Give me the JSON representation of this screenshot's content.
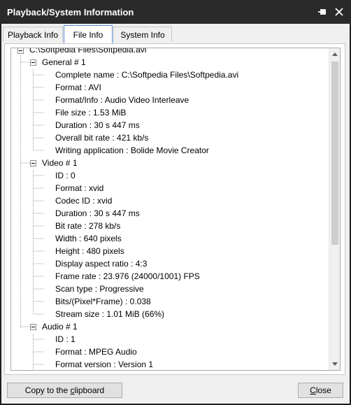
{
  "window": {
    "title": "Playback/System Information",
    "pin_icon": "pin-icon",
    "close_icon": "close-icon"
  },
  "tabs": [
    {
      "label": "Playback Info",
      "active": false
    },
    {
      "label": "File Info",
      "active": true
    },
    {
      "label": "System Info",
      "active": false
    }
  ],
  "tree": {
    "root": "C:\\Softpedia Files\\Softpedia.avi",
    "sections": [
      {
        "label": "General # 1",
        "items": [
          "Complete name : C:\\Softpedia Files\\Softpedia.avi",
          "Format : AVI",
          "Format/Info : Audio Video Interleave",
          "File size : 1.53 MiB",
          "Duration : 30 s 447 ms",
          "Overall bit rate : 421 kb/s",
          "Writing application : Bolide Movie Creator"
        ]
      },
      {
        "label": "Video # 1",
        "items": [
          "ID : 0",
          "Format : xvid",
          "Codec ID : xvid",
          "Duration : 30 s 447 ms",
          "Bit rate : 278 kb/s",
          "Width : 640 pixels",
          "Height : 480 pixels",
          "Display aspect ratio : 4:3",
          "Frame rate : 23.976 (24000/1001) FPS",
          "Scan type : Progressive",
          "Bits/(Pixel*Frame) : 0.038",
          "Stream size : 1.01 MiB (66%)"
        ]
      },
      {
        "label": "Audio # 1",
        "items": [
          "ID : 1",
          "Format : MPEG Audio",
          "Format version : Version 1"
        ]
      }
    ]
  },
  "buttons": {
    "copy_label_prefix": "Copy to the ",
    "copy_label_accel": "c",
    "copy_label_suffix": "lipboard",
    "close_label_accel": "C",
    "close_label_rest": "lose"
  },
  "colors": {
    "titlebar": "#2a2a2a",
    "active_tab_border": "#5a8fd6"
  }
}
